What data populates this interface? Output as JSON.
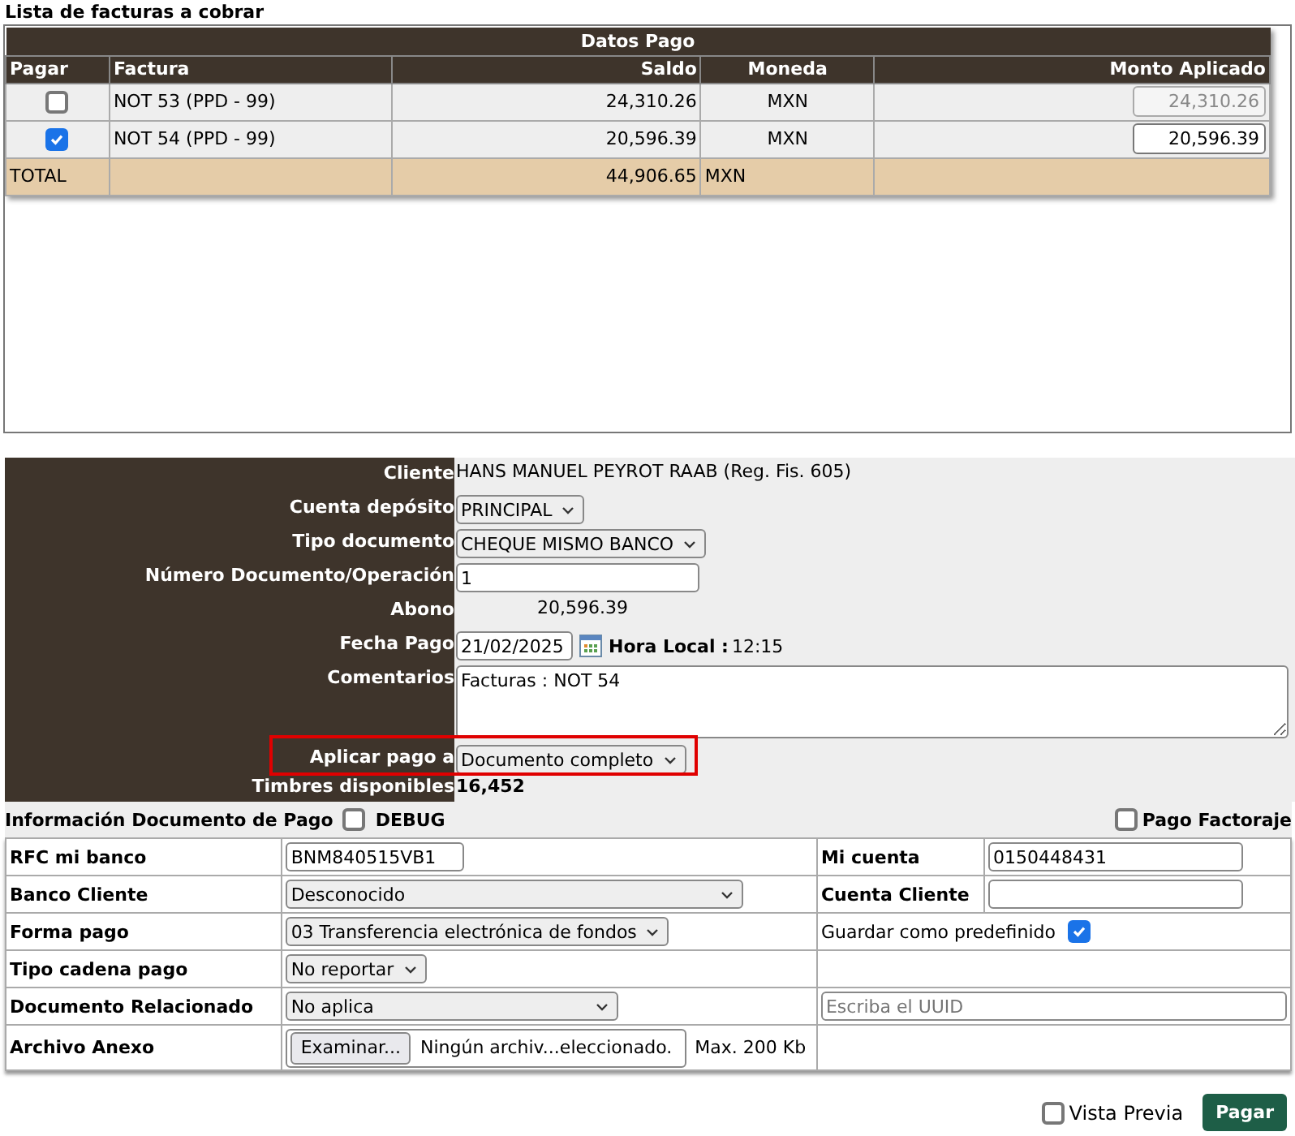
{
  "invoice_list": {
    "title": "Lista de facturas a cobrar",
    "group_header": "Datos Pago",
    "columns": [
      "Pagar",
      "Factura",
      "Saldo",
      "Moneda",
      "Monto Aplicado"
    ],
    "rows": [
      {
        "checked": false,
        "factura": "NOT 53 (PPD - 99)",
        "saldo": "24,310.26",
        "moneda": "MXN",
        "monto": "24,310.26",
        "disabled": true
      },
      {
        "checked": true,
        "factura": "NOT 54 (PPD - 99)",
        "saldo": "20,596.39",
        "moneda": "MXN",
        "monto": "20,596.39",
        "disabled": false
      }
    ],
    "total": {
      "label": "TOTAL",
      "saldo": "44,906.65",
      "moneda": "MXN"
    }
  },
  "payment_form": {
    "fields": [
      {
        "kind": "text",
        "label": "Cliente",
        "value": "HANS MANUEL PEYROT RAAB (Reg. Fis. 605)"
      },
      {
        "kind": "select",
        "label": "Cuenta depósito",
        "value": "PRINCIPAL"
      },
      {
        "kind": "select",
        "label": "Tipo documento",
        "value": "CHEQUE MISMO BANCO"
      },
      {
        "kind": "input",
        "label": "Número Documento/Operación",
        "value": "1"
      },
      {
        "kind": "amount",
        "label": "Abono",
        "value": "20,596.39"
      },
      {
        "kind": "date",
        "label": "Fecha Pago",
        "value": "21/02/2025",
        "extra_label": "Hora Local :",
        "extra_value": "12:15"
      },
      {
        "kind": "textarea",
        "label": "Comentarios",
        "value": "Facturas : NOT 54"
      },
      {
        "kind": "select",
        "label": "Aplicar pago a",
        "value": "Documento completo",
        "highlighted": true
      },
      {
        "kind": "bold",
        "label": "Timbres disponibles",
        "value": "16,452"
      }
    ]
  },
  "document_info": {
    "title": "Información Documento de Pago",
    "debug": {
      "label": "DEBUG",
      "checked": false
    },
    "factoraje": {
      "label": "Pago Factoraje",
      "checked": false
    },
    "rows": [
      {
        "label": "RFC mi banco",
        "field": {
          "kind": "input",
          "value": "BNM840515VB1"
        },
        "right": {
          "kind": "labeled_input",
          "label": "Mi cuenta",
          "value": "0150448431"
        }
      },
      {
        "label": "Banco Cliente",
        "field": {
          "kind": "select",
          "value": "Desconocido"
        },
        "right": {
          "kind": "labeled_input",
          "label": "Cuenta Cliente"
        }
      },
      {
        "label": "Forma pago",
        "field": {
          "kind": "select",
          "value": "03 Transferencia electrónica de fondos"
        },
        "right": {
          "kind": "checkbox",
          "label": "Guardar como predefinido",
          "checked": true
        }
      },
      {
        "label": "Tipo cadena pago",
        "field": {
          "kind": "select",
          "value": "No reportar"
        },
        "right": {
          "kind": "empty"
        }
      },
      {
        "label": "Documento Relacionado",
        "field": {
          "kind": "select",
          "value": "No aplica"
        },
        "right": {
          "kind": "placeholder_input",
          "placeholder": "Escriba el UUID"
        }
      },
      {
        "label": "Archivo Anexo",
        "field": {
          "kind": "file",
          "button": "Examinar...",
          "value": "Ningún archiv...eleccionado.",
          "note": "Max. 200 Kb"
        },
        "right": {
          "kind": "empty"
        }
      }
    ]
  },
  "footer": {
    "preview": {
      "label": "Vista Previa",
      "checked": false
    },
    "submit": "Pagar"
  }
}
